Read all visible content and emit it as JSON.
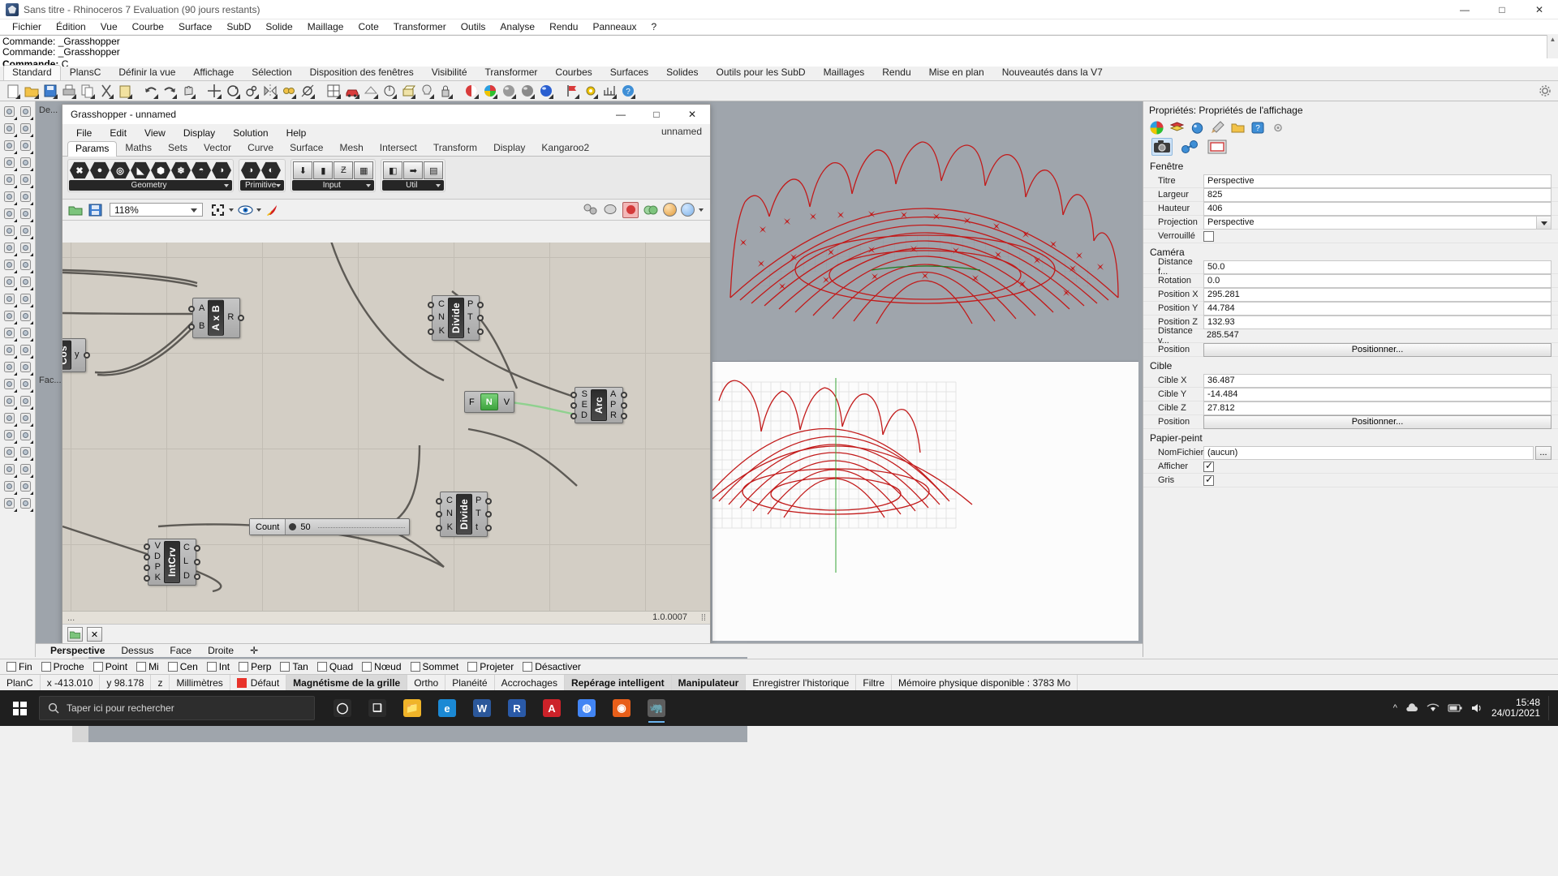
{
  "window": {
    "title": "Sans titre - Rhinoceros 7 Evaluation (90 jours restants)",
    "min": "—",
    "max": "□",
    "close": "✕"
  },
  "menubar": {
    "items": [
      "Fichier",
      "Édition",
      "Vue",
      "Courbe",
      "Surface",
      "SubD",
      "Solide",
      "Maillage",
      "Cote",
      "Transformer",
      "Outils",
      "Analyse",
      "Rendu",
      "Panneaux",
      "?"
    ]
  },
  "command": {
    "history": [
      "Commande: _Grasshopper",
      "Commande: _Grasshopper"
    ],
    "prompt_label": "Commande:",
    "prompt_value": "C"
  },
  "toolbar_tabs": {
    "items": [
      "Standard",
      "PlansC",
      "Définir la vue",
      "Affichage",
      "Sélection",
      "Disposition des fenêtres",
      "Visibilité",
      "Transformer",
      "Courbes",
      "Surfaces",
      "Solides",
      "Outils pour les SubD",
      "Maillages",
      "Rendu",
      "Mise en plan",
      "Nouveautés dans la V7"
    ],
    "active": "Standard"
  },
  "dock_label": "De...",
  "dock_label2": "Fac...",
  "grasshopper": {
    "title": "Grasshopper - unnamed",
    "document_name": "unnamed",
    "win_min": "—",
    "win_max": "□",
    "win_close": "✕",
    "menu": [
      "File",
      "Edit",
      "View",
      "Display",
      "Solution",
      "Help"
    ],
    "tabs": [
      "Params",
      "Maths",
      "Sets",
      "Vector",
      "Curve",
      "Surface",
      "Mesh",
      "Intersect",
      "Transform",
      "Display",
      "Kangaroo2"
    ],
    "active_tab": "Params",
    "palette_groups": [
      {
        "label": "Geometry",
        "icons": [
          "✖",
          "●",
          "◎",
          "◣",
          "⬢",
          "❄",
          "◓",
          "◑"
        ]
      },
      {
        "label": "Primitive",
        "icons": [
          "◑",
          "◐"
        ]
      },
      {
        "label": "Input",
        "icons": [
          "⬇",
          "▮",
          "Ƶ",
          "▦"
        ]
      },
      {
        "label": "Util",
        "icons": [
          "◧",
          "➡",
          "▤"
        ]
      }
    ],
    "canvas_toolbar": {
      "open_icon": "folder-open-icon",
      "save_icon": "save-icon",
      "zoom_value": "118%",
      "zoom_extents_icon": "zoom-extents-icon",
      "preview_icon": "eye-icon",
      "bake_icon": "bake-icon"
    },
    "version": "1.0.0007",
    "status_dots": "...",
    "nodes": [
      {
        "name": "AxB",
        "label": "A x B",
        "inputs": [
          "A",
          "B"
        ],
        "outputs": [
          "R"
        ]
      },
      {
        "name": "Cos",
        "label": "Cos",
        "inputs": [],
        "outputs": [
          "y"
        ]
      },
      {
        "name": "DivideTop",
        "label": "Divide",
        "inputs": [
          "C",
          "N",
          "K"
        ],
        "outputs": [
          "P",
          "T",
          "t"
        ]
      },
      {
        "name": "DivideBottom",
        "label": "Divide",
        "inputs": [
          "C",
          "N",
          "K"
        ],
        "outputs": [
          "P",
          "T",
          "t"
        ]
      },
      {
        "name": "Arc",
        "label": "Arc",
        "inputs": [
          "S",
          "E",
          "D"
        ],
        "outputs": [
          "A",
          "P",
          "R"
        ]
      },
      {
        "name": "IntCrv",
        "label": "IntCrv",
        "inputs": [
          "V",
          "D",
          "P",
          "K"
        ],
        "outputs": [
          "C",
          "L",
          "D"
        ]
      },
      {
        "name": "NumberSlider",
        "label": "N",
        "left": "F",
        "right": "V"
      }
    ],
    "slider": {
      "label": "Count",
      "value": "50"
    }
  },
  "viewport_tabs": {
    "items": [
      "Perspective",
      "Dessus",
      "Face",
      "Droite"
    ],
    "active": "Perspective",
    "add": "✛"
  },
  "properties": {
    "title": "Propriétés: Propriétés de l'affichage",
    "tabs": [
      "color-wheel-icon",
      "layer-icon",
      "render-icon",
      "brush-icon",
      "folder-icon",
      "help-icon",
      "gear-icon"
    ],
    "tabs2": [
      "camera-icon",
      "chain-icon",
      "frame-icon"
    ],
    "sections": [
      {
        "name": "Fenêtre",
        "rows": [
          {
            "key": "Titre",
            "value": "Perspective",
            "type": "text"
          },
          {
            "key": "Largeur",
            "value": "825",
            "type": "text"
          },
          {
            "key": "Hauteur",
            "value": "406",
            "type": "text"
          },
          {
            "key": "Projection",
            "value": "Perspective",
            "type": "combo"
          },
          {
            "key": "Verrouillé",
            "value": "",
            "type": "checkbox",
            "checked": false
          }
        ]
      },
      {
        "name": "Caméra",
        "rows": [
          {
            "key": "Distance f...",
            "value": "50.0",
            "type": "text"
          },
          {
            "key": "Rotation",
            "value": "0.0",
            "type": "text"
          },
          {
            "key": "Position X",
            "value": "295.281",
            "type": "text"
          },
          {
            "key": "Position Y",
            "value": "44.784",
            "type": "text"
          },
          {
            "key": "Position Z",
            "value": "132.93",
            "type": "text"
          },
          {
            "key": "Distance v...",
            "value": "285.547",
            "type": "readonly"
          },
          {
            "key": "Position",
            "value": "Positionner...",
            "type": "button"
          }
        ]
      },
      {
        "name": "Cible",
        "rows": [
          {
            "key": "Cible X",
            "value": "36.487",
            "type": "text"
          },
          {
            "key": "Cible Y",
            "value": "-14.484",
            "type": "text"
          },
          {
            "key": "Cible Z",
            "value": "27.812",
            "type": "text"
          },
          {
            "key": "Position",
            "value": "Positionner...",
            "type": "button"
          }
        ]
      },
      {
        "name": "Papier-peint",
        "rows": [
          {
            "key": "NomFichier",
            "value": "(aucun)",
            "type": "file"
          },
          {
            "key": "Afficher",
            "value": "",
            "type": "checkbox",
            "checked": true
          },
          {
            "key": "Gris",
            "value": "",
            "type": "checkbox",
            "checked": true
          }
        ]
      }
    ]
  },
  "osnap": {
    "items": [
      "Fin",
      "Proche",
      "Point",
      "Mi",
      "Cen",
      "Int",
      "Perp",
      "Tan",
      "Quad",
      "Nœud",
      "Sommet",
      "Projeter",
      "Désactiver"
    ]
  },
  "statusbar": {
    "cplane": "PlanC",
    "x": "x -413.010",
    "y": "y 98.178",
    "z": "z",
    "units": "Millimètres",
    "layer": "Défaut",
    "layer_color": "#e8332a",
    "toggles": [
      "Magnétisme de la grille",
      "Ortho",
      "Planéité",
      "Accrochages",
      "Repérage intelligent",
      "Manipulateur"
    ],
    "highlight": [
      "Magnétisme de la grille",
      "Repérage intelligent",
      "Manipulateur"
    ],
    "record": "Enregistrer l'historique",
    "filter": "Filtre",
    "memory": "Mémoire physique disponible : 3783 Mo"
  },
  "taskbar": {
    "search_placeholder": "Taper ici pour rechercher",
    "search_icon": "search-icon",
    "start_icon": "windows-icon",
    "apps": [
      {
        "name": "cortana",
        "glyph": "◯",
        "color": "#2b2b2b",
        "active": false
      },
      {
        "name": "task-view",
        "glyph": "❑",
        "color": "#2b2b2b",
        "active": false
      },
      {
        "name": "file-explorer",
        "glyph": "📁",
        "color": "#f0b429",
        "active": false
      },
      {
        "name": "edge",
        "glyph": "e",
        "color": "#1b89d4",
        "active": false
      },
      {
        "name": "word",
        "glyph": "W",
        "color": "#2b579a",
        "active": false
      },
      {
        "name": "rhino",
        "glyph": "R",
        "color": "#2a5aa8",
        "active": false
      },
      {
        "name": "autodesk",
        "glyph": "A",
        "color": "#cc2229",
        "active": false
      },
      {
        "name": "chrome",
        "glyph": "◍",
        "color": "#4285f4",
        "active": false
      },
      {
        "name": "firefox",
        "glyph": "◉",
        "color": "#e85f1a",
        "active": false
      },
      {
        "name": "rhino-running",
        "glyph": "🦏",
        "color": "#5d5d5d",
        "active": true
      }
    ],
    "clock_time": "15:48",
    "clock_date": "24/01/2021",
    "tray_icons": [
      "^",
      "wifi-icon",
      "cloud-icon",
      "battery-icon",
      "volume-icon"
    ]
  }
}
